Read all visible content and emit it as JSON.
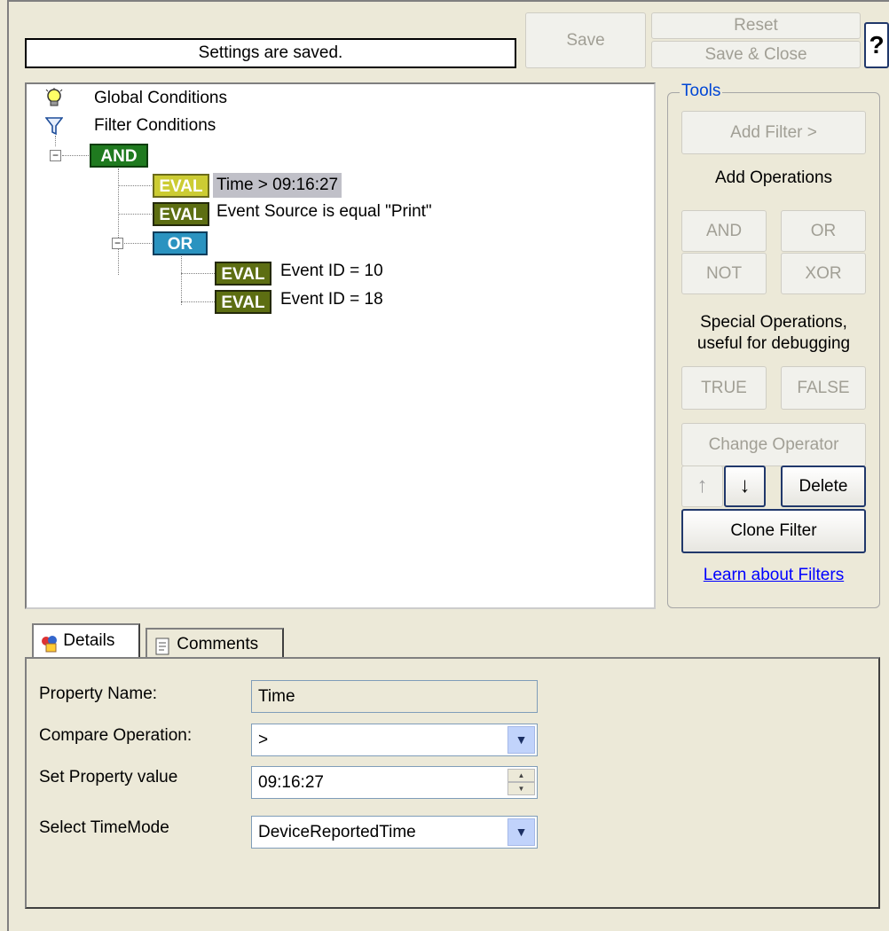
{
  "status": {
    "text": "Settings are saved."
  },
  "toolbar": {
    "save": "Save",
    "reset": "Reset",
    "save_close": "Save & Close",
    "help": "?"
  },
  "tree": {
    "global": "Global Conditions",
    "filter": "Filter Conditions",
    "and_badge": "AND",
    "or_badge": "OR",
    "eval_badge": "EVAL",
    "items": [
      "Time > 09:16:27",
      "Event Source is equal \"Print\"",
      "Event ID = 10",
      "Event ID = 18"
    ]
  },
  "tools": {
    "legend": "Tools",
    "add_filter": "Add Filter >",
    "add_ops": "Add Operations",
    "and": "AND",
    "or": "OR",
    "not": "NOT",
    "xor": "XOR",
    "special_line1": "Special Operations,",
    "special_line2": "useful for debugging",
    "true": "TRUE",
    "false": "FALSE",
    "change_operator": "Change Operator",
    "up": "↑",
    "down": "↓",
    "delete": "Delete",
    "clone": "Clone Filter",
    "learn": "Learn about Filters"
  },
  "tabs": {
    "details": "Details",
    "comments": "Comments"
  },
  "details": {
    "property_name_label": "Property Name:",
    "property_name_value": "Time",
    "compare_label": "Compare Operation:",
    "compare_value": ">",
    "set_value_label": "Set Property value",
    "set_value": "09:16:27",
    "timemode_label": "Select TimeMode",
    "timemode_value": "DeviceReportedTime"
  }
}
